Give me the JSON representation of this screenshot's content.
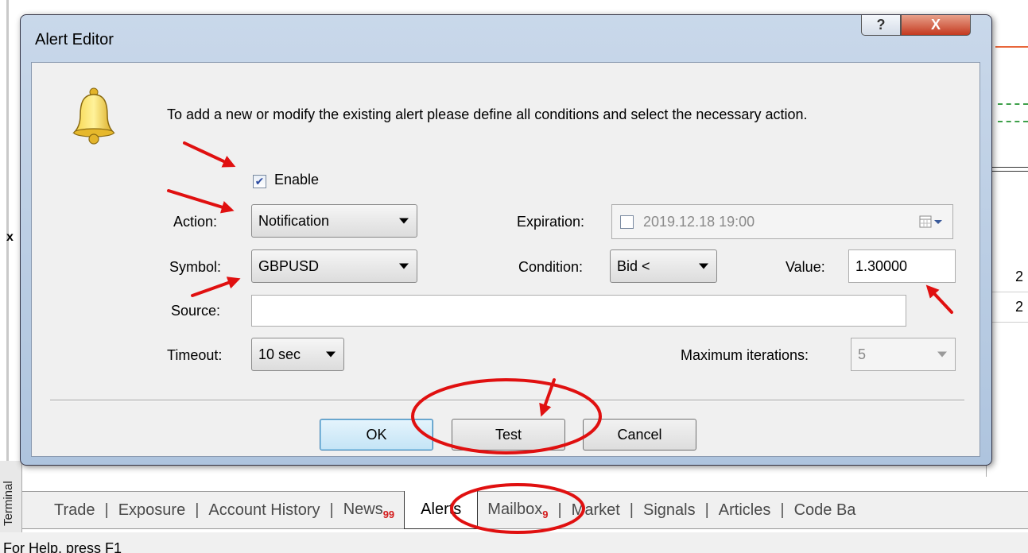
{
  "dialog": {
    "title": "Alert Editor",
    "help_label": "?",
    "close_label": "X",
    "instruction": "To add a new or modify the existing alert please define all conditions and select the necessary action.",
    "enable": {
      "label": "Enable",
      "checked": true
    },
    "action": {
      "label": "Action:",
      "value": "Notification"
    },
    "symbol": {
      "label": "Symbol:",
      "value": "GBPUSD"
    },
    "source": {
      "label": "Source:",
      "value": ""
    },
    "timeout": {
      "label": "Timeout:",
      "value": "10 sec"
    },
    "expiration": {
      "label": "Expiration:",
      "value": "2019.12.18 19:00",
      "checked": false
    },
    "condition": {
      "label": "Condition:",
      "value": "Bid <"
    },
    "value_field": {
      "label": "Value:",
      "value": "1.30000"
    },
    "max_iterations": {
      "label": "Maximum iterations:",
      "value": "5"
    },
    "buttons": {
      "ok": "OK",
      "test": "Test",
      "cancel": "Cancel"
    }
  },
  "terminal": {
    "side_label": "Terminal",
    "tabs": [
      {
        "label": "Trade"
      },
      {
        "label": "Exposure"
      },
      {
        "label": "Account History"
      },
      {
        "label": "News",
        "badge": "99"
      },
      {
        "label": "Alerts",
        "active": true
      },
      {
        "label": "Mailbox",
        "badge": "9"
      },
      {
        "label": "Market"
      },
      {
        "label": "Signals"
      },
      {
        "label": "Articles"
      },
      {
        "label": "Code Ba"
      }
    ],
    "status_text": "For Help, press F1"
  },
  "background": {
    "row_values": [
      "2",
      "2"
    ],
    "close_mark": "x"
  },
  "colors": {
    "annotation_red": "#e01010",
    "dialog_frame": "#b8cce4",
    "default_button": "#3c7fb1"
  }
}
